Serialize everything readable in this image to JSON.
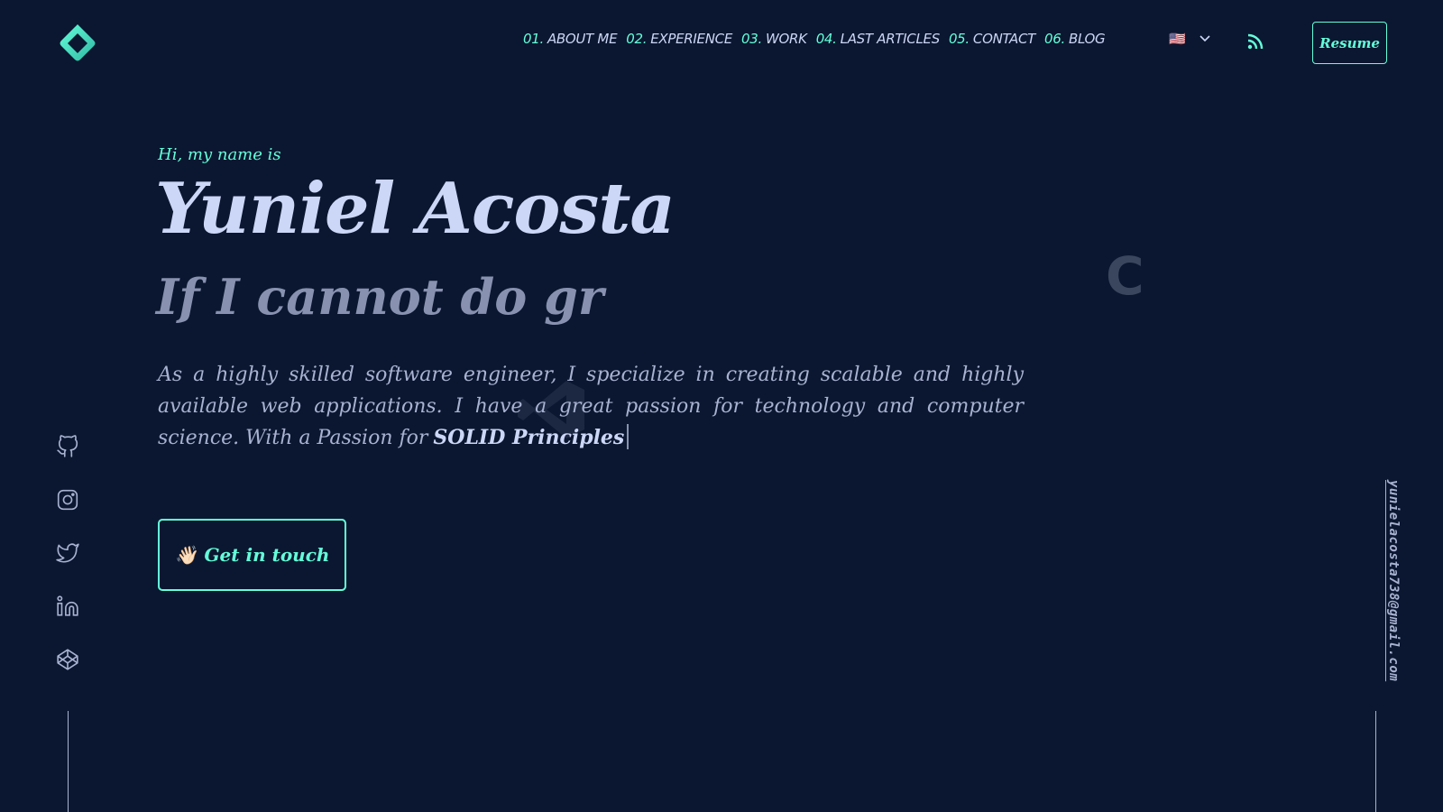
{
  "brand": {
    "logo_icon": "hexagon-ring-logo-icon"
  },
  "nav": [
    {
      "num": "01.",
      "label": "ABOUT ME"
    },
    {
      "num": "02.",
      "label": "EXPERIENCE"
    },
    {
      "num": "03.",
      "label": "WORK"
    },
    {
      "num": "04.",
      "label": "LAST ARTICLES"
    },
    {
      "num": "05.",
      "label": "CONTACT"
    },
    {
      "num": "06.",
      "label": "BLOG"
    }
  ],
  "language": {
    "flag": "🇺🇸",
    "chevron_icon": "chevron-down-icon"
  },
  "rss_icon": "rss-icon",
  "resume_label": "Resume",
  "hero": {
    "greeting": "Hi, my name is",
    "name": "Yuniel Acosta",
    "typing_text": "If I cannot do gr",
    "ghost_letter": "C",
    "bio_text": "As a highly skilled software engineer, I specialize in creating scalable and highly available web applications. I have a great passion for technology and computer science. With a Passion for",
    "bio_highlight": "SOLID Principles",
    "cta_emoji": "👋🏻",
    "cta_label": "Get in touch"
  },
  "socials": [
    "github-icon",
    "instagram-icon",
    "twitter-icon",
    "linkedin-icon",
    "codepen-icon"
  ],
  "email": "yunielacosta738@gmail.com",
  "colors": {
    "bg": "#0b1730",
    "accent": "#64ffda",
    "text": "#ccd6f6",
    "muted": "#8892b0"
  }
}
